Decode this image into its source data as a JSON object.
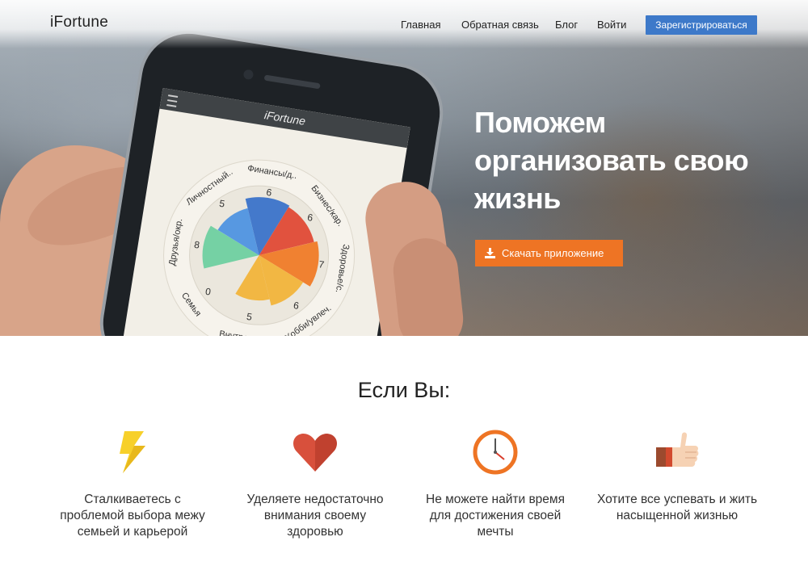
{
  "header": {
    "logo": "iFortune",
    "nav": [
      "Главная",
      "Обратная связь",
      "Блог",
      "Войти"
    ],
    "register": "Зарегистрироваться"
  },
  "hero": {
    "title": "Поможем организовать свою жизнь",
    "download_button": "Скачать приложение",
    "phone_app": {
      "title": "iFortune",
      "segments": [
        "Финансы/д..",
        "Бизнес/кар.",
        "Здоровье/с.",
        "Хобби/увлеч.",
        "Внутренний..",
        "Семья",
        "Друзья/окр.",
        "Личностный.."
      ],
      "scores": [
        "6",
        "6",
        "7",
        "6",
        "5",
        "0",
        "8",
        "5"
      ]
    }
  },
  "section": {
    "title": "Если Вы:",
    "features": [
      {
        "icon": "lightning-icon",
        "text": "Сталкиваетесь с проблемой выбора межу семьей и карьерой"
      },
      {
        "icon": "heart-icon",
        "text": "Уделяете недостаточно внимания своему здоровью"
      },
      {
        "icon": "clock-icon",
        "text": "Не можете найти время для достижения своей мечты"
      },
      {
        "icon": "thumbs-up-icon",
        "text": "Хотите все успевать и жить насыщенной жизнью"
      }
    ]
  },
  "colors": {
    "register_button": "#3d79c9",
    "download_button": "#ee7424",
    "lightning": "#f7d02a",
    "heart": "#d8503c",
    "clock": "#ee7424"
  }
}
